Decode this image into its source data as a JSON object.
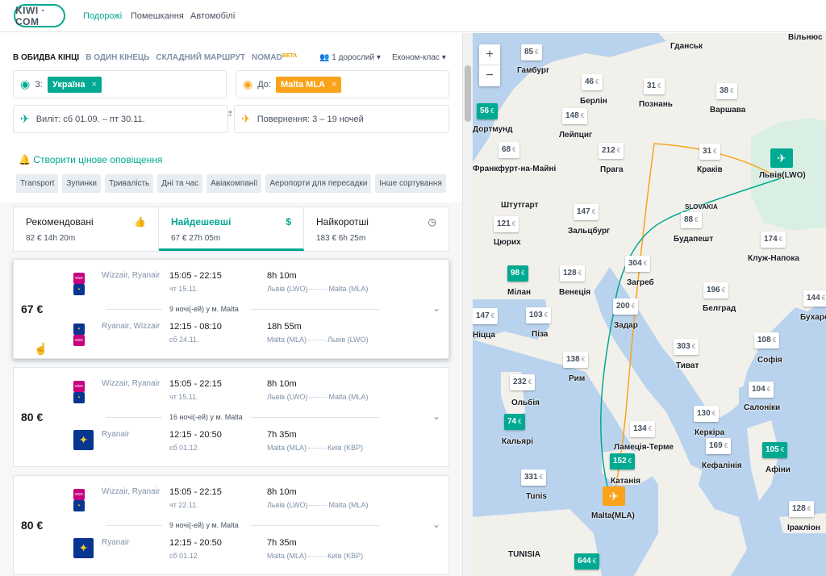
{
  "header": {
    "logo": "KIWI · COM",
    "nav": [
      "Подорожі",
      "Помешкання",
      "Автомобілі"
    ]
  },
  "search": {
    "modes": [
      "В ОБИДВА КІНЦІ",
      "В ОДИН КІНЕЦЬ",
      "СКЛАДНИЙ МАРШРУТ",
      "NOMAD"
    ],
    "beta": "BETA",
    "passengers": "1 дорослий",
    "cabin": "Економ-клас",
    "from_label": "З:",
    "from_chip": "Україна",
    "to_label": "До:",
    "to_chip": "Malta MLA",
    "depart": "Виліт: сб 01.09. – пт 30.11.",
    "return": "Повернення: 3 – 19 ночей",
    "alert": "Створити цінове оповіщення",
    "filters": [
      "Transport",
      "Зупинки",
      "Тривалість",
      "Дні та час",
      "Авіакомпанії",
      "Аеропорти для пересадки",
      "Інше сортування"
    ]
  },
  "sort": [
    {
      "title": "Рекомендовані",
      "sub": "82 €   14h 20m"
    },
    {
      "title": "Найдешевші",
      "sub": "67 €   27h 05m"
    },
    {
      "title": "Найкоротші",
      "sub": "183 €   6h 25m"
    }
  ],
  "results": [
    {
      "price": "67 €",
      "out": {
        "airline": "Wizzair, Ryanair",
        "times": "15:05 - 22:15",
        "date": "чт 15.11.",
        "duration": "8h 10m",
        "from": "Львів (LWO)",
        "to": "Malta (MLA)"
      },
      "nights": "9 ночі(-ей) у м. Malta",
      "back": {
        "airline": "Ryanair, Wizzair",
        "times": "12:15 - 08:10",
        "date": "сб 24.11.",
        "duration": "18h 55m",
        "from": "Malta (MLA)",
        "to": "Львів (LWO)"
      }
    },
    {
      "price": "80 €",
      "out": {
        "airline": "Wizzair, Ryanair",
        "times": "15:05 - 22:15",
        "date": "чт 15.11.",
        "duration": "8h 10m",
        "from": "Львів (LWO)",
        "to": "Malta (MLA)"
      },
      "nights": "16 ночі(-ей) у м. Malta",
      "back": {
        "airline": "Ryanair",
        "times": "12:15 - 20:50",
        "date": "сб 01.12.",
        "duration": "7h 35m",
        "from": "Malta (MLA)",
        "to": "Київ (KBP)"
      }
    },
    {
      "price": "80 €",
      "out": {
        "airline": "Wizzair, Ryanair",
        "times": "15:05 - 22:15",
        "date": "чт 22.11.",
        "duration": "8h 10m",
        "from": "Львів (LWO)",
        "to": "Malta (MLA)"
      },
      "nights": "9 ночі(-ей) у м. Malta",
      "back": {
        "airline": "Ryanair",
        "times": "12:15 - 20:50",
        "date": "сб 01.12.",
        "duration": "7h 35m",
        "from": "Malta (MLA)",
        "to": "Київ (KBP)"
      }
    }
  ],
  "map": {
    "euro": "€",
    "prices": [
      "85",
      "46",
      "31",
      "38",
      "56",
      "148",
      "212",
      "31",
      "68",
      "121",
      "147",
      "88",
      "174",
      "98",
      "128",
      "304",
      "196",
      "147",
      "103",
      "200",
      "144",
      "138",
      "303",
      "108",
      "232",
      "104",
      "130",
      "74",
      "134",
      "169",
      "105",
      "152",
      "331",
      "128",
      "644"
    ],
    "cities": [
      "Гданськ",
      "Вільнюс",
      "Гамбург",
      "Берлін",
      "Познань",
      "Варшава",
      "Дортмунд",
      "Лейпциг",
      "Франкфурт-на-Майні",
      "Прага",
      "Краків",
      "Львів(LWO)",
      "Штутгарт",
      "SLOVAKIA",
      "Зальцбург",
      "Будапешт",
      "Цюрих",
      "Клуж-Напока",
      "Мілан",
      "Венеція",
      "Загреб",
      "Белград",
      "Ніцца",
      "Піза",
      "Задар",
      "Бухарест",
      "Рим",
      "Тиват",
      "Софія",
      "Ольбія",
      "Салоніки",
      "Керкіра",
      "Кальярі",
      "Ламеція-Терме",
      "Кефалінія",
      "Афіни",
      "Катанія",
      "Tunis",
      "Malta(MLA)",
      "Іракліон",
      "TUNISIA"
    ]
  }
}
